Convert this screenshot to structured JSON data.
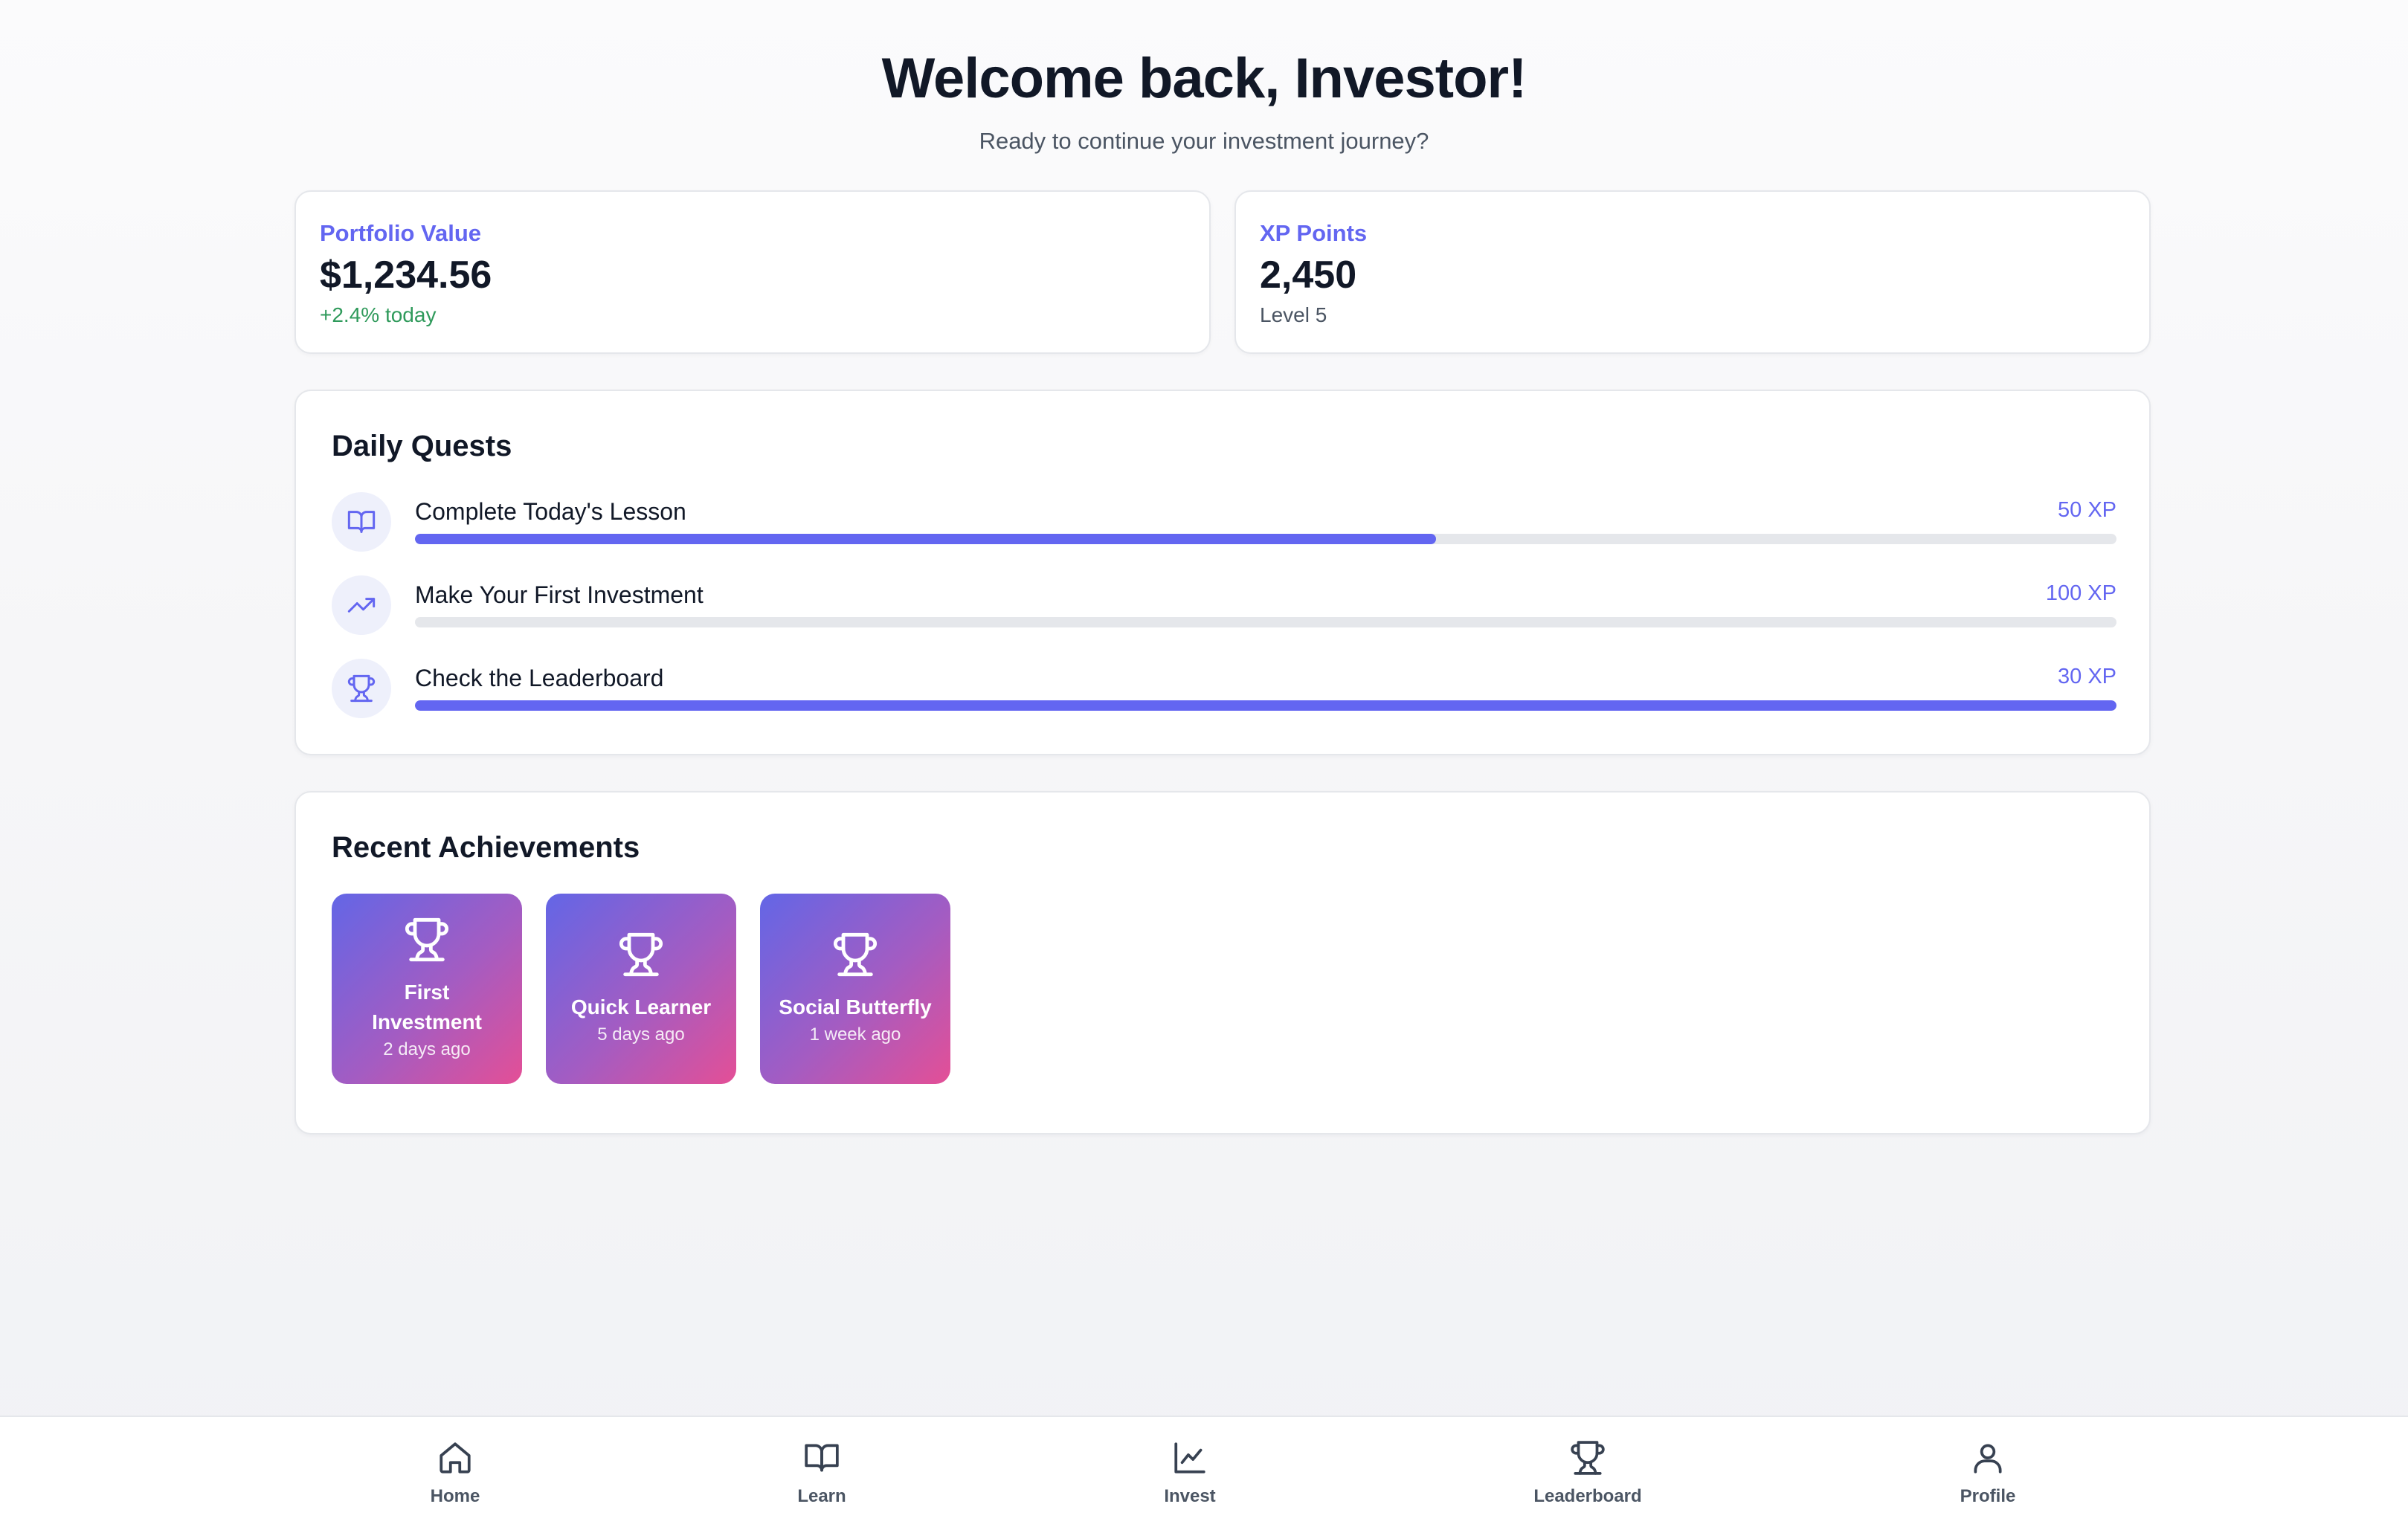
{
  "header": {
    "title": "Welcome back, Investor!",
    "subtitle": "Ready to continue your investment journey?"
  },
  "stats": {
    "portfolio": {
      "label": "Portfolio Value",
      "value": "$1,234.56",
      "sub": "+2.4% today"
    },
    "xp": {
      "label": "XP Points",
      "value": "2,450",
      "sub": "Level 5"
    }
  },
  "quests": {
    "title": "Daily Quests",
    "items": [
      {
        "name": "Complete Today's Lesson",
        "xp": "50 XP",
        "progress": 0.6,
        "icon": "book-icon"
      },
      {
        "name": "Make Your First Investment",
        "xp": "100 XP",
        "progress": 0.0,
        "icon": "trending-up-icon"
      },
      {
        "name": "Check the Leaderboard",
        "xp": "30 XP",
        "progress": 1.0,
        "icon": "trophy-icon"
      }
    ]
  },
  "achievements": {
    "title": "Recent Achievements",
    "items": [
      {
        "name": "First Investment",
        "time": "2 days ago",
        "icon": "trophy-icon"
      },
      {
        "name": "Quick Learner",
        "time": "5 days ago",
        "icon": "trophy-icon"
      },
      {
        "name": "Social Butterfly",
        "time": "1 week ago",
        "icon": "trophy-icon"
      }
    ]
  },
  "nav": {
    "items": [
      {
        "label": "Home",
        "icon": "home-icon"
      },
      {
        "label": "Learn",
        "icon": "book-icon"
      },
      {
        "label": "Invest",
        "icon": "chart-line-icon"
      },
      {
        "label": "Leaderboard",
        "icon": "trophy-icon"
      },
      {
        "label": "Profile",
        "icon": "user-icon"
      }
    ]
  },
  "colors": {
    "accent": "#6366f1",
    "positive": "#2f9a5b",
    "gradient_start": "#6366e6",
    "gradient_end": "#e44f96"
  }
}
